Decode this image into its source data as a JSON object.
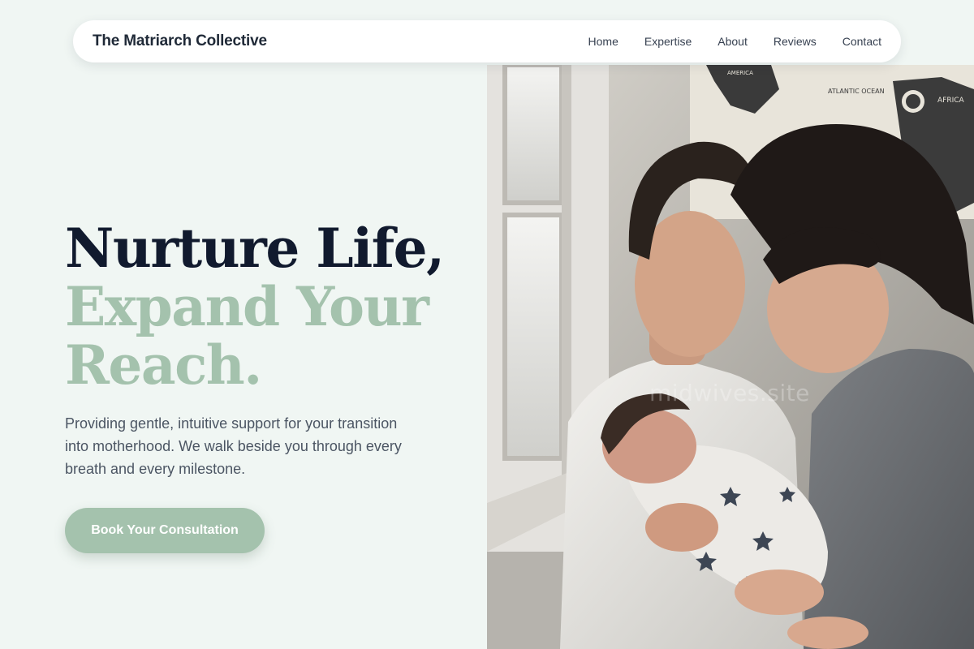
{
  "brand": {
    "name": "The Matriarch Collective"
  },
  "nav": {
    "items": [
      {
        "label": "Home"
      },
      {
        "label": "Expertise"
      },
      {
        "label": "About"
      },
      {
        "label": "Reviews"
      },
      {
        "label": "Contact"
      }
    ]
  },
  "hero": {
    "title_line1": "Nurture Life,",
    "title_line2": "Expand Your",
    "title_line3": "Reach.",
    "subtitle": "Providing gentle, intuitive support for your transition into motherhood. We walk beside you through every breath and every milestone.",
    "cta_label": "Book Your Consultation"
  },
  "image": {
    "alt": "Parents smiling down at their swaddled newborn",
    "watermark": "midwives.site",
    "map_labels": [
      "AMERICA",
      "ATLANTIC OCEAN",
      "AFRICA"
    ]
  },
  "colors": {
    "background": "#f0f6f3",
    "accent": "#a4c2ad",
    "heading": "#111a2e",
    "body_text": "#4b5563"
  }
}
